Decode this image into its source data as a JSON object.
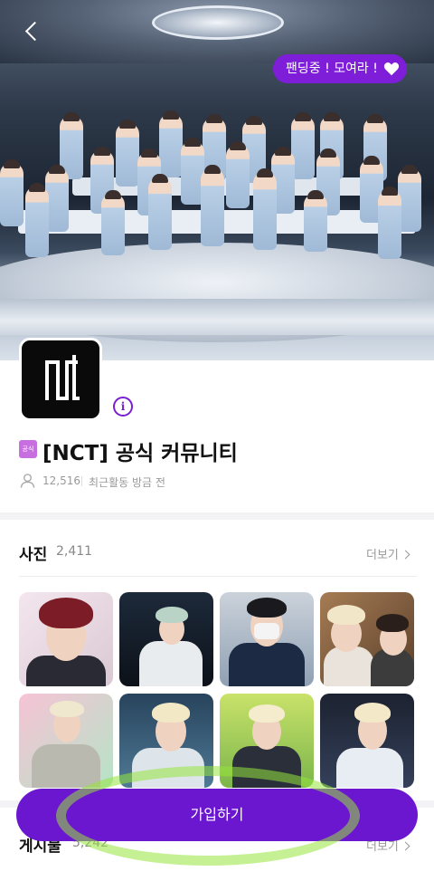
{
  "header": {
    "funding_badge": "팬딩중 ! 모여라 !"
  },
  "community": {
    "official_badge": "공식",
    "title": "[NCT] 공식 커뮤니티",
    "member_count": "12,516",
    "last_activity": "최근활동 방금 전"
  },
  "photos": {
    "title": "사진",
    "count": "2,411",
    "more": "더보기"
  },
  "posts": {
    "title": "게시물",
    "count": "5,242",
    "more": "더보기"
  },
  "join_button": "가입하기",
  "colors": {
    "accent": "#6b16cf",
    "highlight": "#96e63c"
  }
}
